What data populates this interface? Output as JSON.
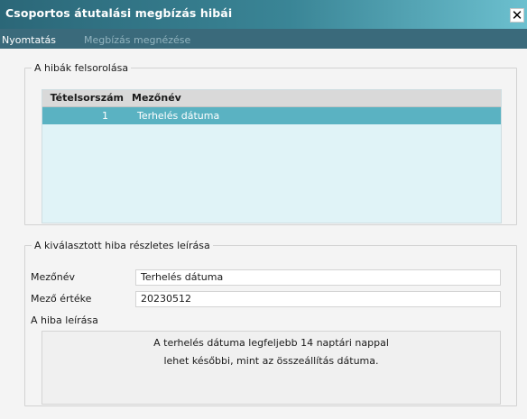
{
  "window": {
    "title": "Csoportos átutalási megbízás hibái",
    "close_glyph": "✕"
  },
  "menu": {
    "items": [
      {
        "label": "Nyomtatás",
        "enabled": true
      },
      {
        "label": "Megbízás megnézése",
        "enabled": false
      }
    ]
  },
  "errors_group": {
    "legend": "A hibák felsorolása",
    "columns": [
      "Tételsorszám",
      "Mezőnév"
    ],
    "rows": [
      {
        "num": "1",
        "field": "Terhelés dátuma",
        "selected": true
      }
    ]
  },
  "detail_group": {
    "legend": "A kiválasztott hiba részletes leírása",
    "field_name_label": "Mezőnév",
    "field_name_value": "Terhelés dátuma",
    "field_value_label": "Mező értéke",
    "field_value_value": "20230512",
    "description_label": "A hiba leírása",
    "description_lines": [
      "A terhelés dátuma legfeljebb 14 naptári nappal",
      "lehet későbbi, mint az összeállítás dátuma."
    ]
  },
  "colors": {
    "titlebar_start": "#2b6778",
    "titlebar_end": "#6cc0cf",
    "menubar": "#3a6a7b",
    "selected_row": "#5ab2c2",
    "table_background": "#e0f3f7"
  }
}
